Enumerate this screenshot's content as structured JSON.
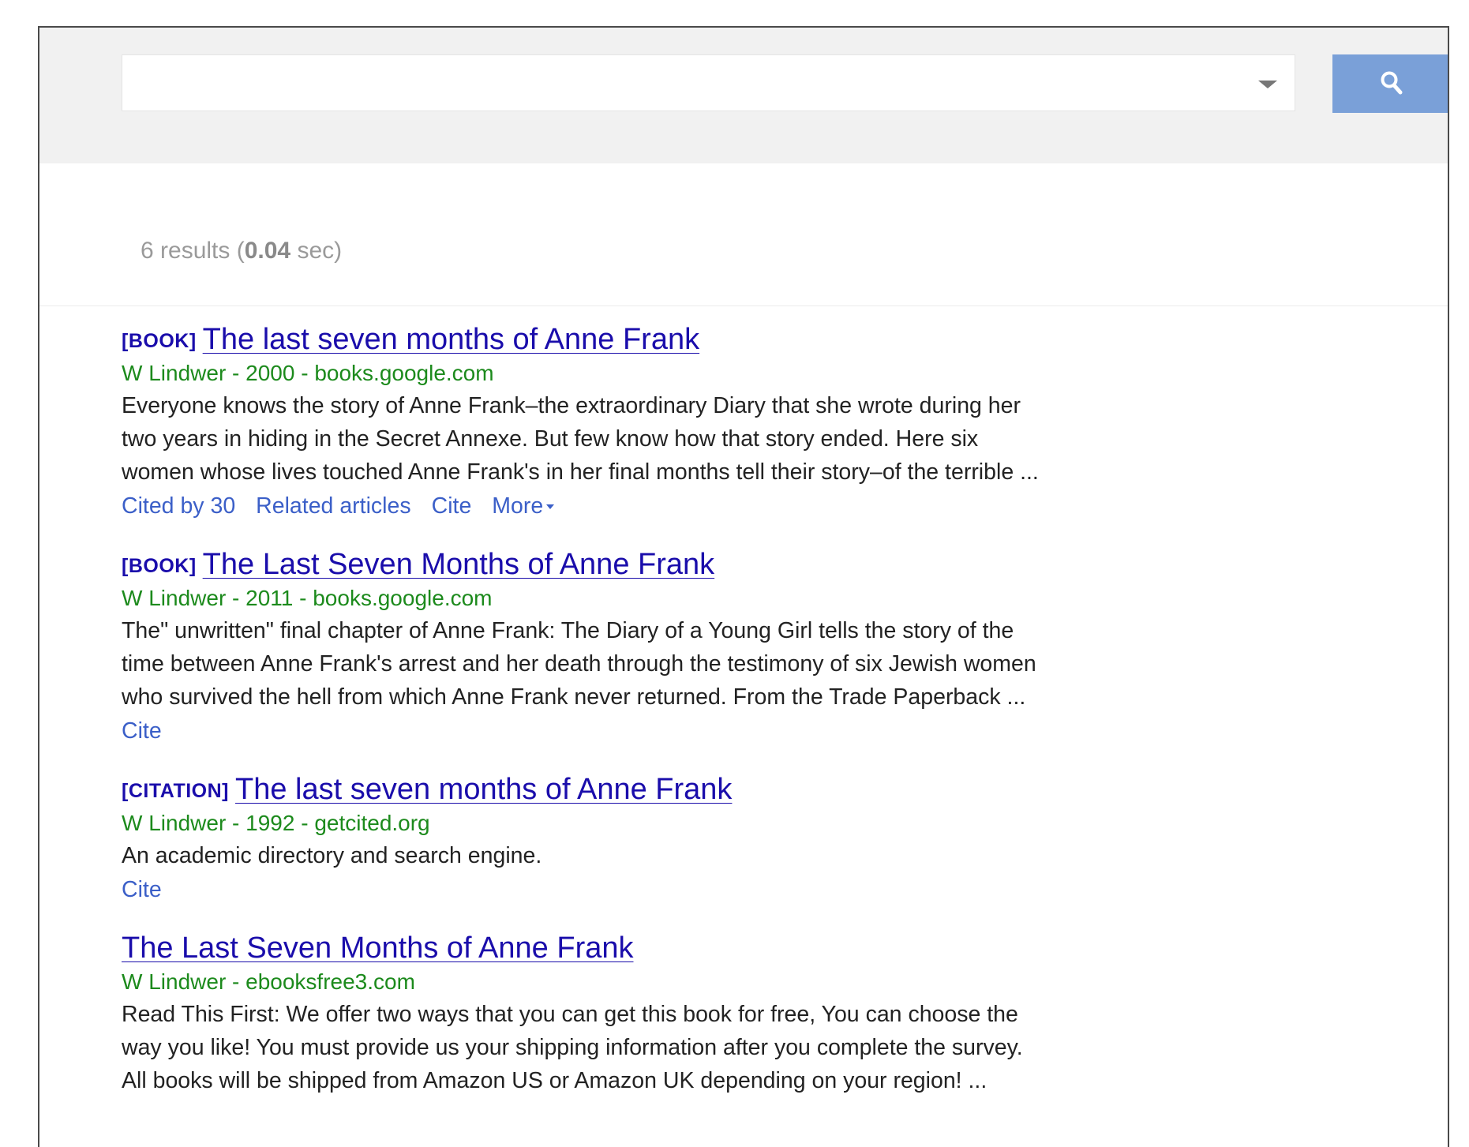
{
  "search": {
    "value": "",
    "placeholder": ""
  },
  "stats": {
    "count_text": "6 results (",
    "time": "0.04",
    "unit_text": " sec)"
  },
  "results": [
    {
      "type": "[BOOK]",
      "title": "The last seven months of Anne Frank",
      "meta": "W Lindwer - 2000 - books.google.com",
      "snippet": [
        "Everyone knows the story of Anne Frank–the extraordinary Diary that she wrote during her",
        "two years in hiding in the Secret Annexe. But few know how that story ended. Here six",
        "women whose lives touched Anne Frank's in her final months tell their story–of the terrible ..."
      ],
      "actions": [
        "Cited by 30",
        "Related articles",
        "Cite",
        "More"
      ]
    },
    {
      "type": "[BOOK]",
      "title": "The Last Seven Months of Anne Frank",
      "meta": "W Lindwer - 2011 - books.google.com",
      "snippet": [
        "The\" unwritten\" final chapter of Anne Frank: The Diary of a Young Girl tells the story of the",
        "time between Anne Frank's arrest and her death through the testimony of six Jewish women",
        "who survived the hell from which Anne Frank never returned. From the Trade Paperback ..."
      ],
      "actions": [
        "Cite"
      ]
    },
    {
      "type": "[CITATION]",
      "title": "The last seven months of Anne Frank",
      "meta": "W Lindwer - 1992 - getcited.org",
      "snippet": [
        "An academic directory and search engine."
      ],
      "actions": [
        "Cite"
      ]
    },
    {
      "type": "",
      "title": "The Last Seven Months of Anne Frank",
      "meta": "W Lindwer - ebooksfree3.com",
      "snippet": [
        "Read This First: We offer two ways that you can get this book for free, You can choose the",
        "way you like! You must provide us your shipping information after you complete the survey.",
        "All books will be shipped from Amazon US or Amazon UK depending on your region! ..."
      ],
      "actions": []
    }
  ],
  "colors": {
    "title_link": "#1a0dab",
    "meta_green": "#1c8a1c",
    "action_link": "#3b5fc8",
    "search_button": "#7aa0d8"
  },
  "icons": {
    "search_button": "search-icon",
    "dropdown": "chevron-down-icon"
  }
}
